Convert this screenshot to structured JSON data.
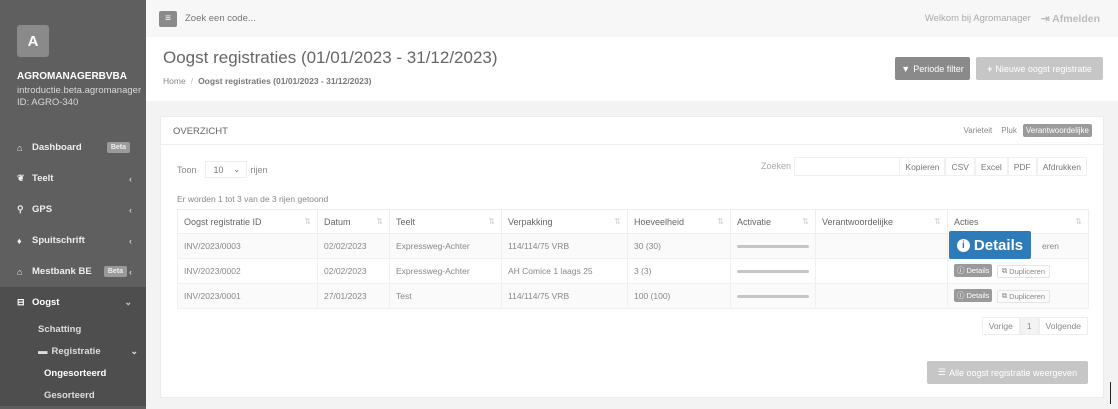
{
  "sidebar": {
    "avatar_letter": "A",
    "company": "AGROMANAGERBVBA",
    "subtitle": "introductie.beta.agromanager",
    "id_line": "ID: AGRO-340",
    "items": [
      {
        "label": "Dashboard",
        "icon": "home-icon",
        "glyph": "⌂",
        "badge": "Beta",
        "chev": ""
      },
      {
        "label": "Teelt",
        "icon": "leaf-icon",
        "glyph": "❦",
        "badge": "",
        "chev": "‹"
      },
      {
        "label": "GPS",
        "icon": "map-marker-icon",
        "glyph": "⚲",
        "badge": "",
        "chev": "‹"
      },
      {
        "label": "Spuitschrift",
        "icon": "drop-icon",
        "glyph": "♦",
        "badge": "",
        "chev": "‹"
      },
      {
        "label": "Mestbank BE",
        "icon": "bank-icon",
        "glyph": "⌂",
        "badge": "Beta",
        "chev": "‹"
      },
      {
        "label": "Oogst",
        "icon": "basket-icon",
        "glyph": "⊟",
        "badge": "",
        "chev": "⌄"
      }
    ],
    "subitems": {
      "schatting": "Schatting",
      "registratie": "Registratie",
      "registratie_icon": "folder-open-icon",
      "ongesorteerd": "Ongesorteerd",
      "gesorteerd": "Gesorteerd"
    }
  },
  "topbar": {
    "search_placeholder": "Zoek een code...",
    "welcome": "Welkom bij Agromanager",
    "logout": "Afmelden"
  },
  "header": {
    "title": "Oogst registraties (01/01/2023 - 31/12/2023)",
    "breadcrumb_home": "Home",
    "breadcrumb_current": "Oogst registraties (01/01/2023 - 31/12/2023)",
    "filter_button": "Periode filter",
    "new_button": "Nieuwe oogst registratie"
  },
  "panel": {
    "title": "OVERZICHT",
    "view_tabs": [
      "Varieteit",
      "Pluk",
      "Verantwoordelijke"
    ],
    "selected_tab": "Verantwoordelijke",
    "show_label": "Toon",
    "page_size": "10",
    "rows_label": "rijen",
    "search_label": "Zoeken",
    "export_buttons": [
      "Kopieren",
      "CSV",
      "Excel",
      "PDF",
      "Afdrukken"
    ],
    "info": "Er worden 1 tot 3 van de 3 rijen getoond",
    "columns": [
      "Oogst registratie ID",
      "Datum",
      "Teelt",
      "Verpakking",
      "Hoeveelheid",
      "Activatie",
      "Verantwoordelijke",
      "Acties"
    ],
    "rows": [
      {
        "id": "INV/2023/0003",
        "datum": "02/02/2023",
        "teelt": "Expressweg-Achter",
        "verpakking": "114/114/75 VRB",
        "hoeveelheid": "30 (30)",
        "verantwoordelijke": ""
      },
      {
        "id": "INV/2023/0002",
        "datum": "02/02/2023",
        "teelt": "Expressweg-Achter",
        "verpakking": "AH Comice 1 laags 25",
        "hoeveelheid": "3 (3)",
        "verantwoordelijke": ""
      },
      {
        "id": "INV/2023/0001",
        "datum": "27/01/2023",
        "teelt": "Test",
        "verpakking": "114/114/75 VRB",
        "hoeveelheid": "100 (100)",
        "verantwoordelijke": ""
      }
    ],
    "details_label": "Details",
    "duplicate_label": "Dupliceren",
    "duplicate_partial": "eren",
    "tooltip": "Details",
    "pager": {
      "prev": "Vorige",
      "page": "1",
      "next": "Volgende"
    },
    "show_all_button": "Alle oogst registratie weergeven"
  }
}
